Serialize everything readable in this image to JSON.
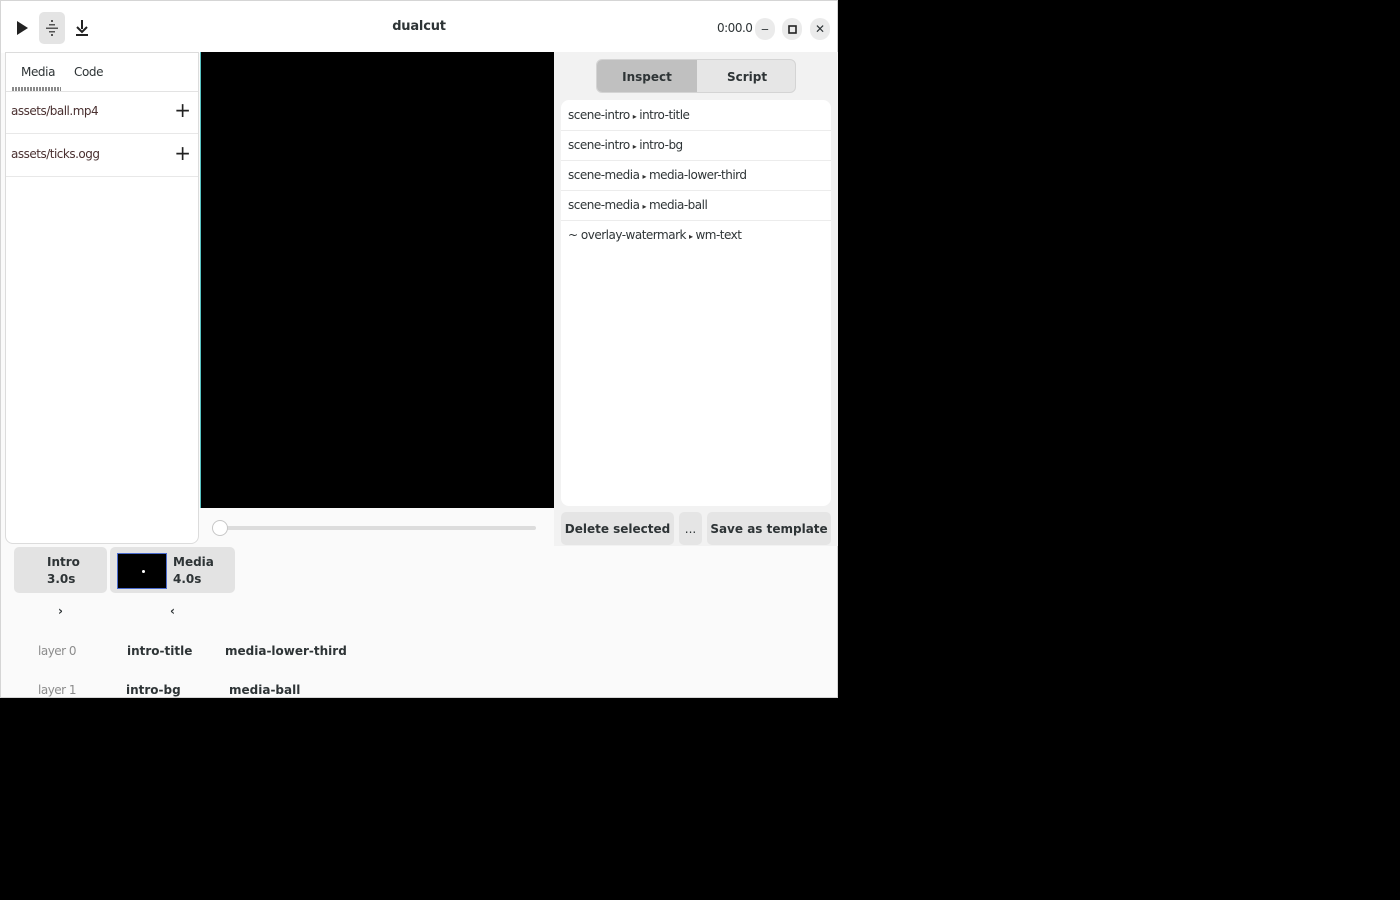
{
  "app": {
    "title": "dualcut",
    "time": "0:00.0",
    "buttons": {
      "play": "play-icon",
      "split": "split-icon",
      "export": "download-icon",
      "minimize": "minimize-icon",
      "maximize": "maximize-icon",
      "close": "close-icon"
    },
    "win_buttons": {
      "minimize": "‒",
      "close": "✕"
    }
  },
  "sidebar": {
    "tabs": [
      {
        "label": "Media",
        "active": true
      },
      {
        "label": "Code",
        "active": false
      }
    ],
    "media": [
      {
        "name": "assets/ball.mp4",
        "add": "+"
      },
      {
        "name": "assets/ticks.ogg",
        "add": "+"
      }
    ]
  },
  "preview": {
    "scrub_fraction": 0
  },
  "inspector": {
    "tabs": [
      {
        "label": "Inspect",
        "active": true
      },
      {
        "label": "Script",
        "active": false
      }
    ],
    "items": [
      {
        "prefix": "",
        "scene": "scene-intro",
        "sep": "▸",
        "layer": "intro-title"
      },
      {
        "prefix": "",
        "scene": "scene-intro",
        "sep": "▸",
        "layer": "intro-bg"
      },
      {
        "prefix": "",
        "scene": "scene-media",
        "sep": "▸",
        "layer": "media-lower-third"
      },
      {
        "prefix": "",
        "scene": "scene-media",
        "sep": "▸",
        "layer": "media-ball"
      },
      {
        "prefix": "~ ",
        "scene": "overlay-watermark",
        "sep": "▸",
        "layer": "wm-text"
      }
    ],
    "actions": {
      "delete": "Delete selected",
      "more": "...",
      "save_template": "Save as template"
    }
  },
  "timeline": {
    "scenes": [
      {
        "name": "Intro",
        "duration": "3.0s"
      },
      {
        "name": "Media",
        "duration": "4.0s"
      }
    ],
    "chevrons": [
      "›",
      "‹"
    ],
    "layers": [
      {
        "label": "layer 0",
        "clips": [
          "intro-title",
          "media-lower-third"
        ]
      },
      {
        "label": "layer 1",
        "clips": [
          "intro-bg",
          "media-ball"
        ]
      }
    ]
  }
}
